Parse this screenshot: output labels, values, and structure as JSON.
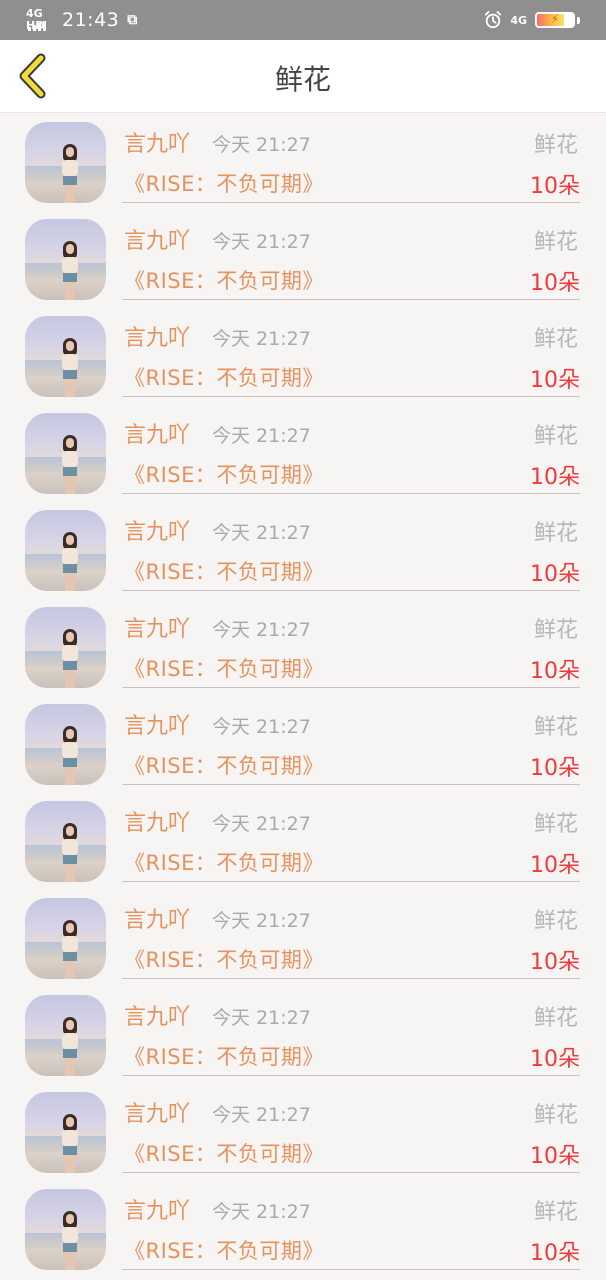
{
  "status": {
    "network_left": "4G HD",
    "time": "21:43",
    "network_right": "4G"
  },
  "nav": {
    "title": "鲜花"
  },
  "rows": [
    {
      "name": "言九吖",
      "time": "今天 21:27",
      "gift": "鲜花",
      "song": "《RISE：不负可期》",
      "count": "10朵"
    },
    {
      "name": "言九吖",
      "time": "今天 21:27",
      "gift": "鲜花",
      "song": "《RISE：不负可期》",
      "count": "10朵"
    },
    {
      "name": "言九吖",
      "time": "今天 21:27",
      "gift": "鲜花",
      "song": "《RISE：不负可期》",
      "count": "10朵"
    },
    {
      "name": "言九吖",
      "time": "今天 21:27",
      "gift": "鲜花",
      "song": "《RISE：不负可期》",
      "count": "10朵"
    },
    {
      "name": "言九吖",
      "time": "今天 21:27",
      "gift": "鲜花",
      "song": "《RISE：不负可期》",
      "count": "10朵"
    },
    {
      "name": "言九吖",
      "time": "今天 21:27",
      "gift": "鲜花",
      "song": "《RISE：不负可期》",
      "count": "10朵"
    },
    {
      "name": "言九吖",
      "time": "今天 21:27",
      "gift": "鲜花",
      "song": "《RISE：不负可期》",
      "count": "10朵"
    },
    {
      "name": "言九吖",
      "time": "今天 21:27",
      "gift": "鲜花",
      "song": "《RISE：不负可期》",
      "count": "10朵"
    },
    {
      "name": "言九吖",
      "time": "今天 21:27",
      "gift": "鲜花",
      "song": "《RISE：不负可期》",
      "count": "10朵"
    },
    {
      "name": "言九吖",
      "time": "今天 21:27",
      "gift": "鲜花",
      "song": "《RISE：不负可期》",
      "count": "10朵"
    },
    {
      "name": "言九吖",
      "time": "今天 21:27",
      "gift": "鲜花",
      "song": "《RISE：不负可期》",
      "count": "10朵"
    },
    {
      "name": "言九吖",
      "time": "今天 21:27",
      "gift": "鲜花",
      "song": "《RISE：不负可期》",
      "count": "10朵"
    }
  ],
  "icons": {
    "back": "chevron-left-icon",
    "alarm": "alarm-clock-icon",
    "battery": "battery-charging-icon"
  },
  "colors": {
    "accent_orange": "#e6925d",
    "count_red": "#ef3a3a",
    "back_yellow": "#f3dc3a"
  }
}
